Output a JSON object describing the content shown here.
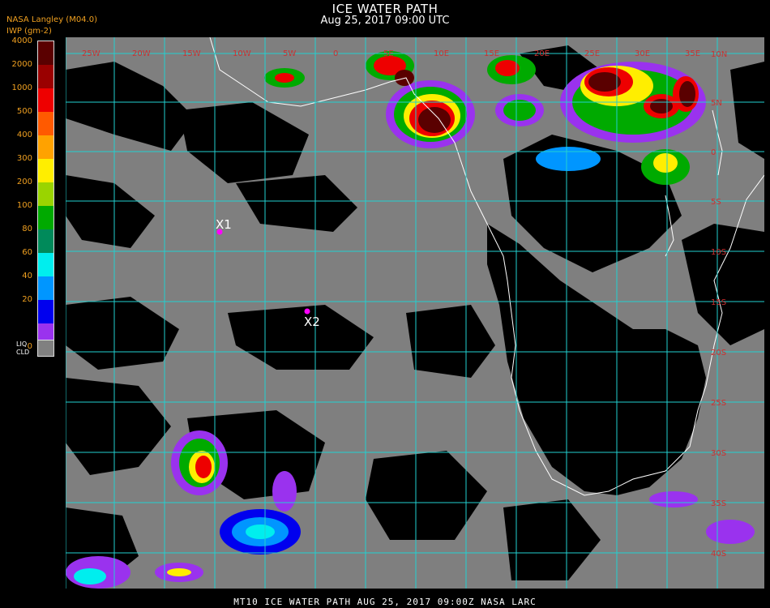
{
  "title": "ICE WATER PATH",
  "subtitle": "Aug 25, 2017 09:00 UTC",
  "source": "NASA Langley (M04.0)",
  "unit": "IWP (gm-2)",
  "colorbar": [
    {
      "label": "4000",
      "color": "#5a0000"
    },
    {
      "label": "2000",
      "color": "#9a0000"
    },
    {
      "label": "1000",
      "color": "#ee0000"
    },
    {
      "label": "500",
      "color": "#ff5a00"
    },
    {
      "label": "400",
      "color": "#ffa200"
    },
    {
      "label": "300",
      "color": "#ffee00"
    },
    {
      "label": "200",
      "color": "#9ad400"
    },
    {
      "label": "100",
      "color": "#00aa00"
    },
    {
      "label": "80",
      "color": "#008a5a"
    },
    {
      "label": "60",
      "color": "#00eeee"
    },
    {
      "label": "40",
      "color": "#0096ff"
    },
    {
      "label": "20",
      "color": "#0000ee"
    },
    {
      "label": "",
      "color": "#9a32ee"
    }
  ],
  "colorbar_bottom_label": "0",
  "liquid_cloud": {
    "label_top": "LIQ",
    "label_bottom": "CLD",
    "color": "#808080"
  },
  "lon_labels": [
    "25W",
    "20W",
    "15W",
    "10W",
    "5W",
    "0",
    "5E",
    "10E",
    "15E",
    "20E",
    "25E",
    "30E",
    "35E"
  ],
  "lat_labels": [
    "10N",
    "5N",
    "0",
    "5S",
    "10S",
    "15S",
    "20S",
    "25S",
    "30S",
    "35S",
    "40S"
  ],
  "markers": [
    {
      "label": "X1",
      "color": "#ff00ff"
    },
    {
      "label": "X2",
      "color": "#ff00ff"
    }
  ],
  "footer": "MT10  ICE WATER PATH  AUG 25, 2017 09:00Z  NASA LARC"
}
